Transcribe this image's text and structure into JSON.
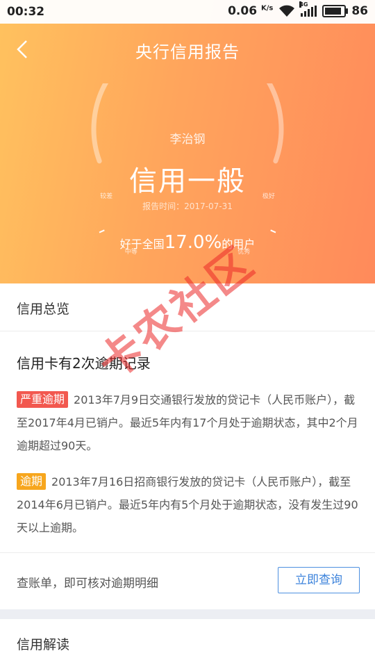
{
  "status_bar": {
    "time": "00:32",
    "speed": "0.06",
    "speed_unit": "K/s",
    "network": "4G",
    "battery": "86",
    "battery_level": 0.86
  },
  "header": {
    "back_icon": "chevron-left-icon",
    "title": "央行信用报告"
  },
  "gauge": {
    "tick_labels": [
      "较差",
      "中等",
      "良好",
      "优秀",
      "极好"
    ],
    "name": "李治钢",
    "status": "信用一般",
    "report_date": "报告时间：2017-07-31",
    "better_prefix": "好于全国",
    "better_value": "17.0%",
    "better_suffix": "的用户"
  },
  "overview": {
    "title": "信用总览"
  },
  "records": {
    "headline": "信用卡有2次逾期记录",
    "items": [
      {
        "badge": "严重逾期",
        "badge_color": "#f2584f",
        "text": "2013年7月9日交通银行发放的贷记卡（人民币账户），截至2017年4月已销户。最近5年内有17个月处于逾期状态，其中2个月逾期超过90天。"
      },
      {
        "badge": "逾期",
        "badge_color": "#f7a61d",
        "text": "2013年7月16日招商银行发放的贷记卡（人民币账户），截至2014年6月已销户。最近5年内有5个月处于逾期状态，没有发生过90天以上逾期。"
      }
    ]
  },
  "check": {
    "text": "查账单，即可核对逾期明细",
    "button": "立即查询"
  },
  "interpret": {
    "title": "信用解读"
  },
  "watermark": "卡农社区",
  "colors": {
    "gradient_start": "#ffc25e",
    "gradient_end": "#ff8a5b",
    "link_blue": "#3b82db"
  }
}
